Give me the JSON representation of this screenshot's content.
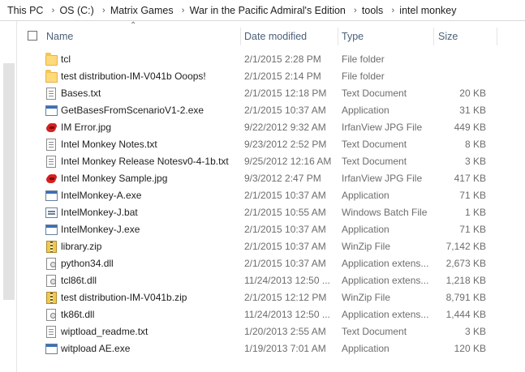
{
  "breadcrumb": [
    "This PC",
    "OS (C:)",
    "Matrix Games",
    "War in the Pacific Admiral's Edition",
    "tools",
    "intel monkey"
  ],
  "columns": {
    "name": "Name",
    "date": "Date modified",
    "type": "Type",
    "size": "Size"
  },
  "files": [
    {
      "name": "tcl",
      "date": "2/1/2015 2:28 PM",
      "type": "File folder",
      "size": "",
      "icon": "folder-icon"
    },
    {
      "name": "test distribution-IM-V041b  Ooops!",
      "date": "2/1/2015 2:14 PM",
      "type": "File folder",
      "size": "",
      "icon": "folder-icon"
    },
    {
      "name": "Bases.txt",
      "date": "2/1/2015 12:18 PM",
      "type": "Text Document",
      "size": "20 KB",
      "icon": "text-file-icon"
    },
    {
      "name": "GetBasesFromScenarioV1-2.exe",
      "date": "2/1/2015 10:37 AM",
      "type": "Application",
      "size": "31 KB",
      "icon": "application-icon"
    },
    {
      "name": "IM Error.jpg",
      "date": "9/22/2012 9:32 AM",
      "type": "IrfanView JPG File",
      "size": "449 KB",
      "icon": "irfanview-image-icon"
    },
    {
      "name": "Intel Monkey Notes.txt",
      "date": "9/23/2012 2:52 PM",
      "type": "Text Document",
      "size": "8 KB",
      "icon": "text-file-icon"
    },
    {
      "name": "Intel Monkey Release Notesv0-4-1b.txt",
      "date": "9/25/2012 12:16 AM",
      "type": "Text Document",
      "size": "3 KB",
      "icon": "text-file-icon"
    },
    {
      "name": "Intel Monkey Sample.jpg",
      "date": "9/3/2012 2:47 PM",
      "type": "IrfanView JPG File",
      "size": "417 KB",
      "icon": "irfanview-image-icon"
    },
    {
      "name": "IntelMonkey-A.exe",
      "date": "2/1/2015 10:37 AM",
      "type": "Application",
      "size": "71 KB",
      "icon": "application-icon"
    },
    {
      "name": "IntelMonkey-J.bat",
      "date": "2/1/2015 10:55 AM",
      "type": "Windows Batch File",
      "size": "1 KB",
      "icon": "batch-file-icon"
    },
    {
      "name": "IntelMonkey-J.exe",
      "date": "2/1/2015 10:37 AM",
      "type": "Application",
      "size": "71 KB",
      "icon": "application-icon"
    },
    {
      "name": "library.zip",
      "date": "2/1/2015 10:37 AM",
      "type": "WinZip File",
      "size": "7,142 KB",
      "icon": "zip-file-icon"
    },
    {
      "name": "python34.dll",
      "date": "2/1/2015 10:37 AM",
      "type": "Application extens...",
      "size": "2,673 KB",
      "icon": "dll-file-icon"
    },
    {
      "name": "tcl86t.dll",
      "date": "11/24/2013 12:50 ...",
      "type": "Application extens...",
      "size": "1,218 KB",
      "icon": "dll-file-icon"
    },
    {
      "name": "test distribution-IM-V041b.zip",
      "date": "2/1/2015 12:12 PM",
      "type": "WinZip File",
      "size": "8,791 KB",
      "icon": "zip-file-icon"
    },
    {
      "name": "tk86t.dll",
      "date": "11/24/2013 12:50 ...",
      "type": "Application extens...",
      "size": "1,444 KB",
      "icon": "dll-file-icon"
    },
    {
      "name": "wiptload_readme.txt",
      "date": "1/20/2013 2:55 AM",
      "type": "Text Document",
      "size": "3 KB",
      "icon": "text-file-icon"
    },
    {
      "name": "witpload AE.exe",
      "date": "1/19/2013 7:01 AM",
      "type": "Application",
      "size": "120 KB",
      "icon": "application-icon"
    }
  ]
}
